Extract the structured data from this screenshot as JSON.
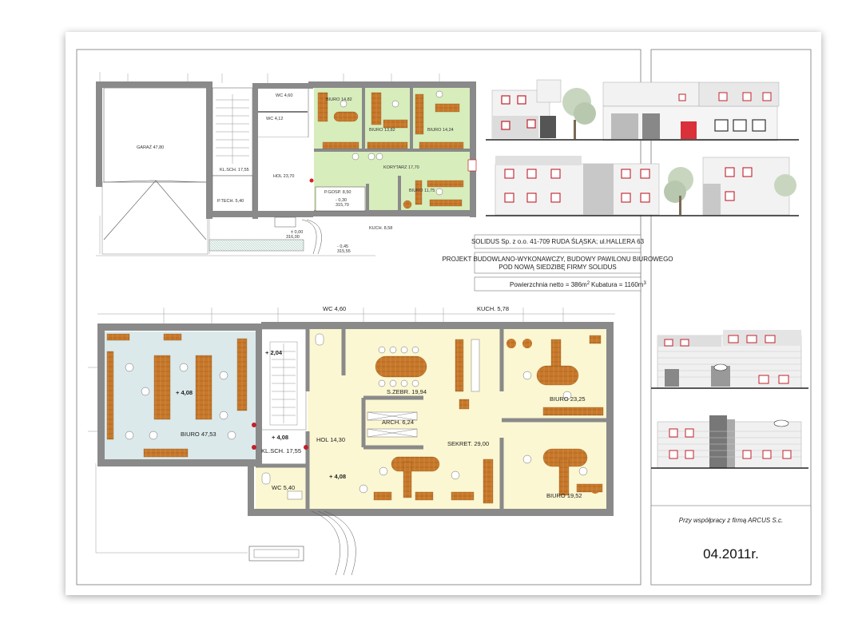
{
  "upper_plan": {
    "rooms": [
      {
        "id": "garaz",
        "label": "GARAŻ 47,80"
      },
      {
        "id": "wc1",
        "label": "WC 4,60"
      },
      {
        "id": "wc2",
        "label": "WC 4,12"
      },
      {
        "id": "biuro1",
        "label": "BIURO 14,82"
      },
      {
        "id": "biuro2",
        "label": "BIURO 13,82"
      },
      {
        "id": "biuro3",
        "label": "BIURO 14,24"
      },
      {
        "id": "klsch",
        "label": "KL.SCH. 17,55"
      },
      {
        "id": "hol",
        "label": "HOL 23,70"
      },
      {
        "id": "korytarz",
        "label": "KORYTARZ 17,70"
      },
      {
        "id": "ptech",
        "label": "P.TECH. 5,40"
      },
      {
        "id": "pgosp",
        "label": "P.GOSP. 8,50"
      },
      {
        "id": "biuro4",
        "label": "BIURO 11,75"
      },
      {
        "id": "kuch",
        "label": "KUCH. 8,58"
      }
    ],
    "levels": [
      {
        "id": "lvl1",
        "line1": "± 0,00",
        "line2": "316,00"
      },
      {
        "id": "lvl2",
        "line1": "- 0,30",
        "line2": "315,70"
      },
      {
        "id": "lvl3",
        "line1": "- 0,45",
        "line2": "315,55"
      }
    ]
  },
  "lower_plan": {
    "rooms": [
      {
        "id": "wc_top",
        "label": "WC 4,60"
      },
      {
        "id": "kuch_top",
        "label": "KUCH. 5,78"
      },
      {
        "id": "biuro_big",
        "label": "BIURO 47,53"
      },
      {
        "id": "szebr",
        "label": "S.ZEBR. 19,94"
      },
      {
        "id": "arch",
        "label": "ARCH. 6,24"
      },
      {
        "id": "sekret",
        "label": "SEKRET. 29,00"
      },
      {
        "id": "biuro_2325",
        "label": "BIURO 23,25"
      },
      {
        "id": "biuro_1952",
        "label": "BIURO 19,52"
      },
      {
        "id": "hol",
        "label": "HOL 14,30"
      },
      {
        "id": "klsch",
        "label": "KL.SCH. 17,55"
      },
      {
        "id": "wc_bottom",
        "label": "WC 5,40"
      }
    ],
    "levels": [
      {
        "id": "l204",
        "text": "+ 2,04"
      },
      {
        "id": "l408a",
        "text": "+ 4,08"
      },
      {
        "id": "l408b",
        "text": "+ 4,08"
      },
      {
        "id": "l408c",
        "text": "+ 4,08"
      }
    ]
  },
  "title_block": {
    "company": "SOLIDUS Sp. z o.o. 41-709 RUDA ŚLĄSKA; ul.HALLERA 63",
    "project_line1": "PROJEKT BUDOWLANO-WYKONAWCZY, BUDOWY PAWILONU BIUROWEGO",
    "project_line2": "POD NOWĄ SIEDZIBĘ FIRMY SOLIDUS",
    "area_label": "Powierzchnia netto = 386m",
    "area_sup": "2",
    "volume_label": "Kubatura = 1160m",
    "volume_sup": "3"
  },
  "credit_block": {
    "cooperation": "Przy współpracy z firmą ARCUS S.c.",
    "date": "04.2011r."
  },
  "colors": {
    "wall": "#8a8a8a",
    "green_zone": "#d8edbc",
    "cream_zone": "#fbf7d2",
    "blue_zone": "#dbe9ea",
    "furniture": "#c77b2a",
    "window_frame": "#c0202a"
  }
}
